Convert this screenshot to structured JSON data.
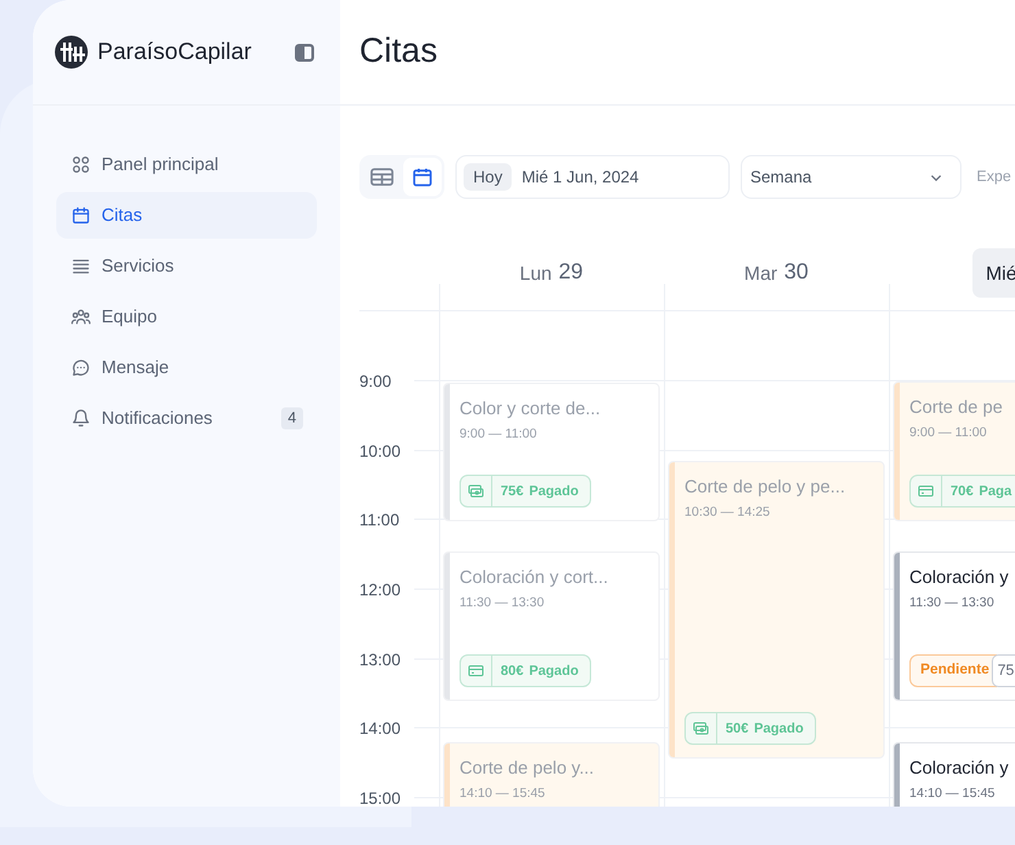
{
  "sidebar": {
    "brand": "ParaísoCapilar",
    "nav": [
      {
        "label": "Panel principal",
        "selected": false
      },
      {
        "label": "Citas",
        "selected": true
      },
      {
        "label": "Servicios",
        "selected": false
      },
      {
        "label": "Equipo",
        "selected": false
      },
      {
        "label": "Mensaje",
        "selected": false
      },
      {
        "label": "Notificaciones",
        "selected": false,
        "badge": "4"
      }
    ]
  },
  "page": {
    "title": "Citas"
  },
  "toolbar": {
    "views": [
      {
        "kind": "table",
        "selected": false
      },
      {
        "kind": "calendar",
        "selected": true
      }
    ],
    "date": {
      "today": "Hoy",
      "value": "Mié 1 Jun, 2024"
    },
    "range": {
      "value": "Semana"
    },
    "next_label": "Expe"
  },
  "hours": [
    "9:00",
    "10:00",
    "11:00",
    "12:00",
    "13:00",
    "14:00",
    "15:00"
  ],
  "days": [
    {
      "name": "Lun",
      "number": "29",
      "selected": false,
      "events": [
        {
          "title": "Color y corte de...",
          "time": "9:00 — 11:00",
          "color": "#e5e7eb",
          "faded": true,
          "payment": {
            "kind": "cash",
            "amount": "75€",
            "status": "Pagado"
          }
        },
        {
          "title": "Coloración y cort...",
          "time": "11:30 — 13:30",
          "color": "#e5e7eb",
          "faded": true,
          "payment": {
            "kind": "card",
            "amount": "80€",
            "status": "Pagado"
          }
        },
        {
          "title": "Corte de pelo y...",
          "time": "14:10 — 15:45",
          "color": "#fde3c8",
          "faded": true
        }
      ]
    },
    {
      "name": "Mar",
      "number": "30",
      "selected": false,
      "events": [
        {
          "title": "Corte de pelo y pe...",
          "time": "10:30 — 14:25",
          "color": "#fde3c8",
          "faded": true,
          "payment": {
            "kind": "cash",
            "amount": "50€",
            "status": "Pagado"
          }
        }
      ]
    },
    {
      "name": "Mié",
      "selected": true,
      "events": [
        {
          "title": "Corte de pe",
          "time": "9:00 — 11:00",
          "color": "#fde3c8",
          "faded": true,
          "payment": {
            "kind": "card",
            "amount": "70€",
            "status": "Paga"
          }
        },
        {
          "title": "Coloración y",
          "time": "11:30 — 13:30",
          "color": "#aab1bc",
          "faded": false,
          "payment": {
            "kind": "pending",
            "status": "Pendiente",
            "amount": "75"
          }
        },
        {
          "title": "Coloración y",
          "time": "14:10 — 15:45",
          "color": "#aab1bc",
          "faded": false
        }
      ]
    }
  ]
}
